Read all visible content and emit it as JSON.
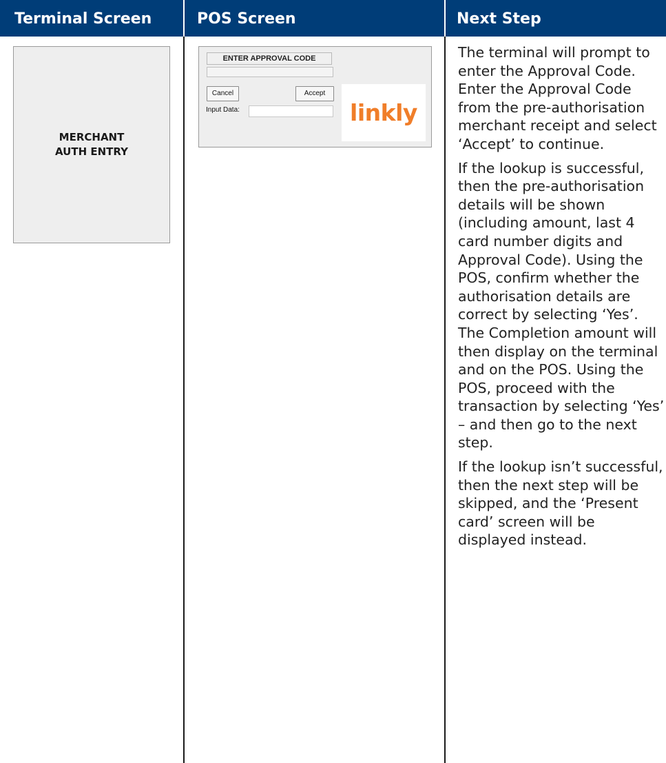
{
  "header": {
    "terminal": "Terminal Screen",
    "pos": "POS Screen",
    "next": "Next Step"
  },
  "terminal_screen": {
    "line1": "MERCHANT",
    "line2": "AUTH ENTRY"
  },
  "pos_screen": {
    "title": "ENTER APPROVAL CODE",
    "cancel_label": "Cancel",
    "accept_label": "Accept",
    "input_label": "Input Data:",
    "input_value": "",
    "logo_text": "linkly"
  },
  "next_step": {
    "p1": "The terminal will prompt to enter the Approval Code. Enter the Approval Code from the pre-authorisation merchant receipt and select ‘Accept’ to continue.",
    "p2": "If the lookup is successful, then the pre-authorisation details will be shown (including amount, last 4 card number digits and Approval Code). Using the POS, confirm whether the authorisation details are correct by selecting ‘Yes’. The Completion amount will then display on the terminal and on the POS. Using the POS, proceed with the transaction by selecting ‘Yes’ – and then go to the next step.",
    "p3": "If the lookup isn’t successful, then the next step will be skipped, and the ‘Present card’ screen will be displayed instead."
  },
  "colors": {
    "header_bg": "#003d78",
    "header_text": "#ffffff",
    "logo": "#f07e2a"
  }
}
